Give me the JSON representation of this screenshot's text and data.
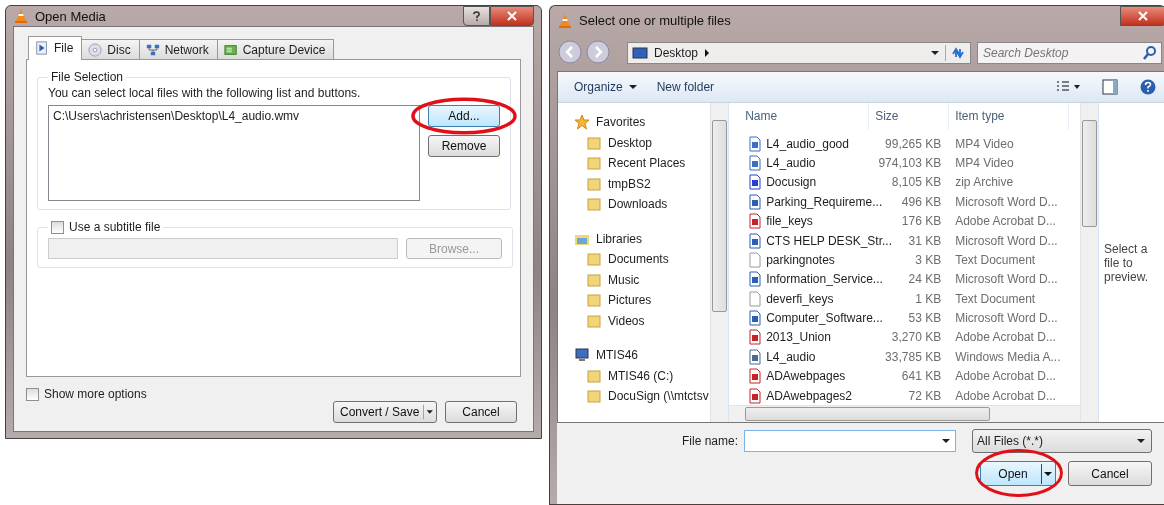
{
  "open_media": {
    "title": "Open Media",
    "tabs": [
      {
        "label": "File",
        "selected": true
      },
      {
        "label": "Disc",
        "selected": false
      },
      {
        "label": "Network",
        "selected": false
      },
      {
        "label": "Capture Device",
        "selected": false
      }
    ],
    "file_selection": {
      "legend": "File Selection",
      "hint": "You can select local files with the following list and buttons.",
      "files": [
        "C:\\Users\\achristensen\\Desktop\\L4_audio.wmv"
      ],
      "buttons": [
        {
          "label": "Add...",
          "focused": true,
          "circled": true
        },
        {
          "label": "Remove",
          "focused": false,
          "circled": false
        }
      ]
    },
    "subtitle": {
      "label": "Use a subtitle file",
      "checked": false,
      "browse": {
        "label": "Browse...",
        "disabled": true
      }
    },
    "show_more_options": {
      "label": "Show more options",
      "checked": false
    },
    "footer_buttons": [
      {
        "label": "Convert / Save",
        "kind": "split"
      },
      {
        "label": "Cancel",
        "kind": "plain"
      }
    ]
  },
  "file_dialog": {
    "title": "Select one or multiple files",
    "address": "Desktop",
    "search": {
      "placeholder": "Search Desktop"
    },
    "toolbar": [
      {
        "label": "Organize",
        "kind": "menu"
      },
      {
        "label": "New folder",
        "kind": "plain"
      }
    ],
    "sidebar": [
      {
        "label": "Favorites",
        "children": [
          {
            "label": "Desktop"
          },
          {
            "label": "Recent Places"
          },
          {
            "label": "tmpBS2"
          },
          {
            "label": "Downloads"
          }
        ]
      },
      {
        "label": "Libraries",
        "children": [
          {
            "label": "Documents"
          },
          {
            "label": "Music"
          },
          {
            "label": "Pictures"
          },
          {
            "label": "Videos"
          }
        ]
      },
      {
        "label": "MTIS46",
        "children": [
          {
            "label": "MTIS46 (C:)"
          },
          {
            "label": "DocuSign (\\\\mtctsv"
          }
        ]
      }
    ],
    "columns": [
      "Name",
      "Size",
      "Item type"
    ],
    "files": [
      {
        "name": "L4_audio_good",
        "size": "99,265 KB",
        "type": "MP4 Video",
        "kind": "video"
      },
      {
        "name": "L4_audio",
        "size": "974,103 KB",
        "type": "MP4 Video",
        "kind": "video"
      },
      {
        "name": "Docusign",
        "size": "8,105 KB",
        "type": "zip Archive",
        "kind": "zip"
      },
      {
        "name": "Parking_Requireme...",
        "size": "496 KB",
        "type": "Microsoft Word D...",
        "kind": "word"
      },
      {
        "name": "file_keys",
        "size": "176 KB",
        "type": "Adobe Acrobat D...",
        "kind": "pdf"
      },
      {
        "name": "CTS HELP DESK_Str...",
        "size": "31 KB",
        "type": "Microsoft Word D...",
        "kind": "word"
      },
      {
        "name": "parkingnotes",
        "size": "3 KB",
        "type": "Text Document",
        "kind": "text"
      },
      {
        "name": "Information_Service...",
        "size": "24 KB",
        "type": "Microsoft Word D...",
        "kind": "word"
      },
      {
        "name": "deverfi_keys",
        "size": "1 KB",
        "type": "Text Document",
        "kind": "text"
      },
      {
        "name": "Computer_Software...",
        "size": "53 KB",
        "type": "Microsoft Word D...",
        "kind": "word"
      },
      {
        "name": "2013_Union",
        "size": "3,270 KB",
        "type": "Adobe Acrobat D...",
        "kind": "pdf"
      },
      {
        "name": "L4_audio",
        "size": "33,785 KB",
        "type": "Windows Media A...",
        "kind": "media"
      },
      {
        "name": "ADAwebpages",
        "size": "641 KB",
        "type": "Adobe Acrobat D...",
        "kind": "pdf"
      },
      {
        "name": "ADAwebpages2",
        "size": "72 KB",
        "type": "Adobe Acrobat D...",
        "kind": "pdf"
      }
    ],
    "preview_text": "Select a file to preview.",
    "file_name": {
      "label": "File name:"
    },
    "filter": "All Files (*.*)",
    "buttons": [
      {
        "label": "Open",
        "kind": "split",
        "circled": true
      },
      {
        "label": "Cancel",
        "kind": "plain",
        "circled": false
      }
    ]
  }
}
